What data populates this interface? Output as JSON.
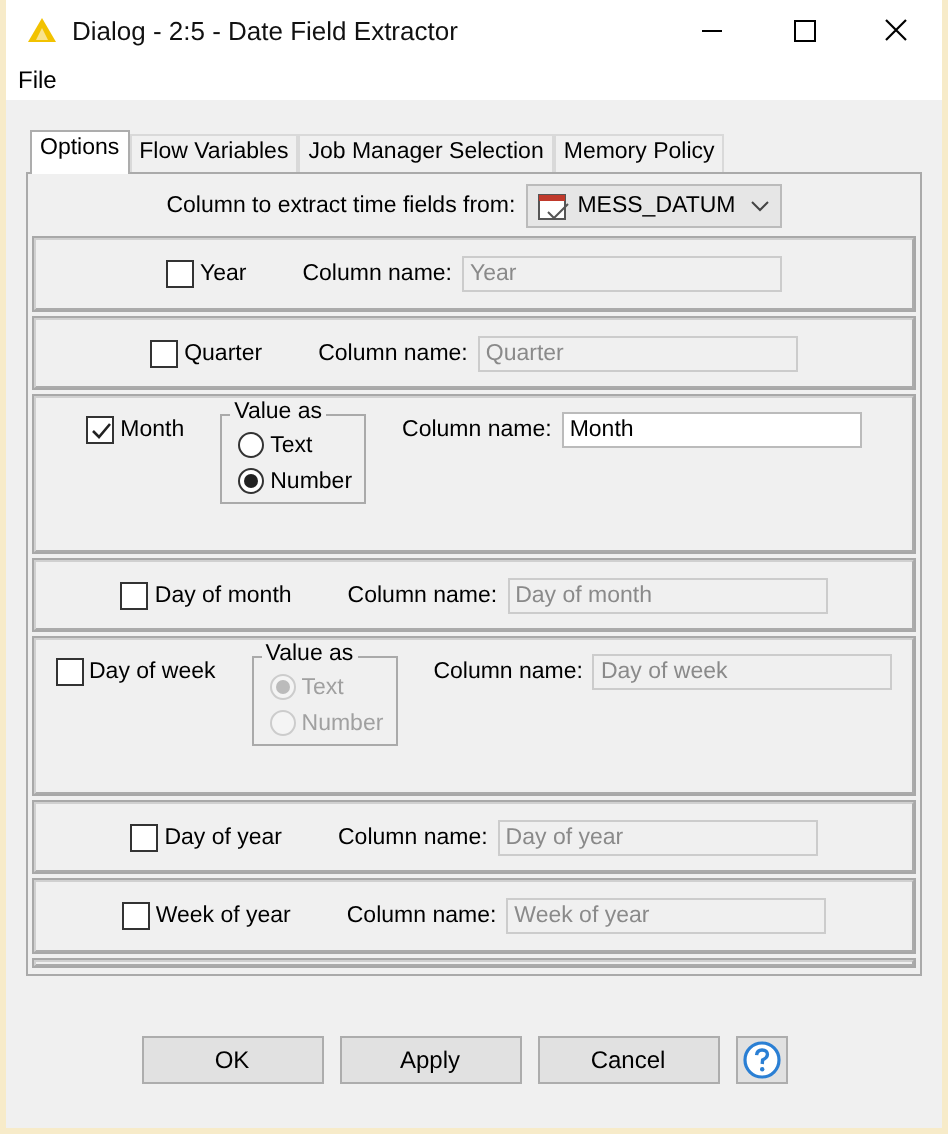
{
  "window": {
    "title": "Dialog - 2:5 - Date Field Extractor"
  },
  "menu": [
    "File"
  ],
  "tabs": [
    {
      "label": "Options",
      "selected": true
    },
    {
      "label": "Flow Variables",
      "selected": false
    },
    {
      "label": "Job Manager Selection",
      "selected": false
    },
    {
      "label": "Memory Policy",
      "selected": false
    }
  ],
  "source_column": {
    "label": "Column to extract time fields from:",
    "value": "MESS_DATUM"
  },
  "fields": [
    {
      "kind": "simple",
      "label": "Year",
      "checked": false,
      "column_label": "Column name:",
      "column_name": "Year"
    },
    {
      "kind": "simple",
      "label": "Quarter",
      "checked": false,
      "column_label": "Column name:",
      "column_name": "Quarter"
    },
    {
      "kind": "value_as",
      "label": "Month",
      "checked": true,
      "group_label": "Value as",
      "options": [
        {
          "label": "Text",
          "selected": false
        },
        {
          "label": "Number",
          "selected": true
        }
      ],
      "column_label": "Column name:",
      "column_name": "Month"
    },
    {
      "kind": "simple",
      "label": "Day of month",
      "checked": false,
      "column_label": "Column name:",
      "column_name": "Day of month"
    },
    {
      "kind": "value_as",
      "label": "Day of week",
      "checked": false,
      "group_label": "Value as",
      "options": [
        {
          "label": "Text",
          "selected": true
        },
        {
          "label": "Number",
          "selected": false
        }
      ],
      "column_label": "Column name:",
      "column_name": "Day of week"
    },
    {
      "kind": "simple",
      "label": "Day of year",
      "checked": false,
      "column_label": "Column name:",
      "column_name": "Day of year"
    },
    {
      "kind": "simple",
      "label": "Week of year",
      "checked": false,
      "column_label": "Column name:",
      "column_name": "Week of year"
    }
  ],
  "buttons": [
    {
      "kind": "text",
      "label": "OK"
    },
    {
      "kind": "text",
      "label": "Apply"
    },
    {
      "kind": "text",
      "label": "Cancel"
    },
    {
      "kind": "help"
    }
  ]
}
